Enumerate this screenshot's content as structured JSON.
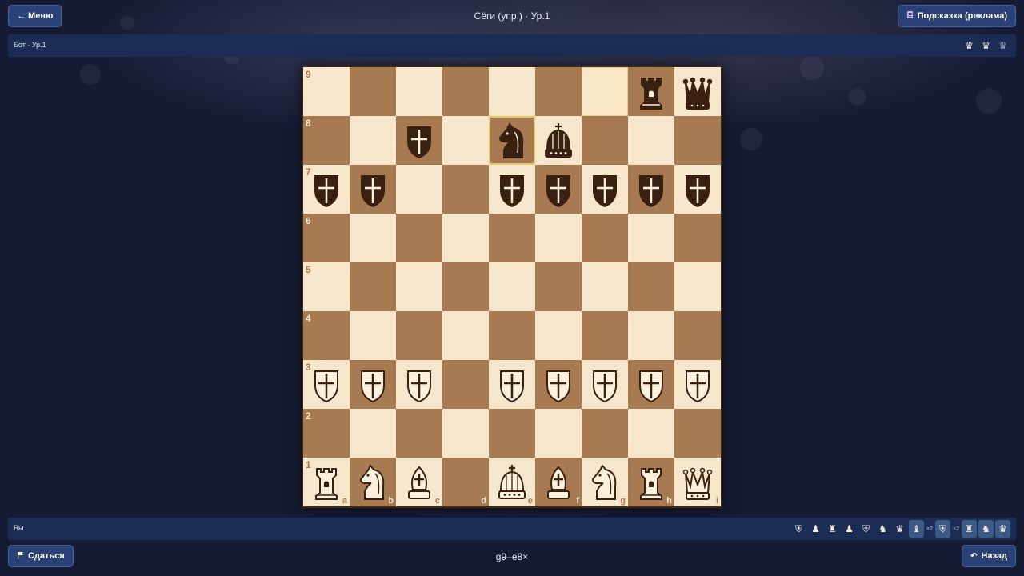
{
  "header": {
    "menu_label": "← Меню",
    "title": "Сёги (упр.) · Ур.1",
    "hint_label": "Подсказка (реклама)",
    "hint_icon": "hint-scroll-icon"
  },
  "opponent_bar": {
    "label": "Бот · Ур.1",
    "pieces": [
      {
        "icon": "queen-icon",
        "glyph": "♛",
        "style": "normal"
      },
      {
        "icon": "queen-icon",
        "glyph": "♛",
        "style": "normal"
      },
      {
        "icon": "queen-icon",
        "glyph": "♛",
        "style": "dim"
      }
    ]
  },
  "player_bar": {
    "label": "Вы",
    "pieces": [
      {
        "icon": "shield-icon",
        "glyph": "⛨",
        "style": "normal",
        "count": ""
      },
      {
        "icon": "pawn-icon",
        "glyph": "♟",
        "style": "normal",
        "count": ""
      },
      {
        "icon": "rook-icon",
        "glyph": "♜",
        "style": "normal",
        "count": ""
      },
      {
        "icon": "pawn-icon",
        "glyph": "♟",
        "style": "normal",
        "count": ""
      },
      {
        "icon": "shield-icon",
        "glyph": "⛨",
        "style": "normal",
        "count": ""
      },
      {
        "icon": "knight-icon",
        "glyph": "♞",
        "style": "normal",
        "count": ""
      },
      {
        "icon": "queen-icon",
        "glyph": "♛",
        "style": "normal",
        "count": ""
      },
      {
        "icon": "bishop-icon",
        "glyph": "♝",
        "style": "hl",
        "count": "×2"
      },
      {
        "icon": "shield-icon",
        "glyph": "⛨",
        "style": "hl",
        "count": "×2"
      },
      {
        "icon": "rook-icon",
        "glyph": "♜",
        "style": "hl",
        "count": ""
      },
      {
        "icon": "knight-icon",
        "glyph": "♞",
        "style": "hl",
        "count": ""
      },
      {
        "icon": "queen-icon",
        "glyph": "♛",
        "style": "hl",
        "count": ""
      }
    ]
  },
  "board": {
    "files": [
      "a",
      "b",
      "c",
      "d",
      "e",
      "f",
      "g",
      "h",
      "i"
    ],
    "ranks": [
      "9",
      "8",
      "7",
      "6",
      "5",
      "4",
      "3",
      "2",
      "1"
    ],
    "rows": [
      [
        "",
        "",
        "",
        "",
        "",
        "",
        "",
        "bR",
        "bQ"
      ],
      [
        "",
        "",
        "bS",
        "",
        "bN",
        "bK",
        "",
        "",
        ""
      ],
      [
        "bS",
        "bS",
        "",
        "",
        "bS",
        "bS",
        "bS",
        "bS",
        "bS"
      ],
      [
        "",
        "",
        "",
        "",
        "",
        "",
        "",
        "",
        ""
      ],
      [
        "",
        "",
        "",
        "",
        "",
        "",
        "",
        "",
        ""
      ],
      [
        "",
        "",
        "",
        "",
        "",
        "",
        "",
        "",
        ""
      ],
      [
        "wS",
        "wS",
        "wS",
        "",
        "wS",
        "wS",
        "wS",
        "wS",
        "wS"
      ],
      [
        "",
        "",
        "",
        "",
        "",
        "",
        "",
        "",
        ""
      ],
      [
        "wR",
        "wN",
        "wB",
        "",
        "wK",
        "wB",
        "wN",
        "wR",
        "wQ"
      ]
    ],
    "last_move_from": "g9",
    "last_move_to": "e8",
    "colors": {
      "light": "#f6e6cc",
      "dark": "#a87a52",
      "highlight": "#e6c56a"
    }
  },
  "footer": {
    "resign_label": "Сдаться",
    "resign_icon": "flag-icon",
    "move_text": "g9–e8×",
    "back_label": "Назад",
    "back_icon": "undo-arrow-icon"
  }
}
